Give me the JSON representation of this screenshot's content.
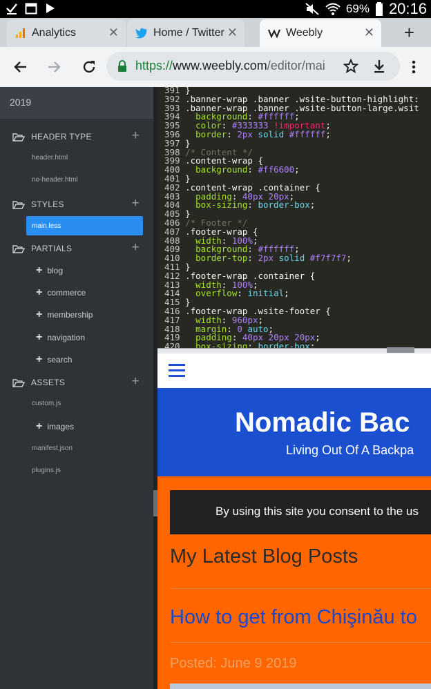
{
  "status_bar": {
    "battery": "69%",
    "time": "20:16"
  },
  "tabs": [
    {
      "title": "Analytics",
      "icon": "analytics-icon"
    },
    {
      "title": "Home / Twitter",
      "icon": "twitter-icon"
    },
    {
      "title": "Weebly",
      "icon": "weebly-icon",
      "active": true
    }
  ],
  "toolbar": {
    "url_scheme": "https://",
    "url_host": "www.weebly.com",
    "url_path": "/editor/mai"
  },
  "sidebar": {
    "year": "2019",
    "sections": {
      "header_type": {
        "label": "HEADER TYPE",
        "files": [
          "header.html",
          "no-header.html"
        ]
      },
      "styles": {
        "label": "STYLES",
        "active_file": "main.less"
      },
      "partials": {
        "label": "PARTIALS",
        "folders": [
          "blog",
          "commerce",
          "membership",
          "navigation",
          "search"
        ]
      },
      "assets": {
        "label": "ASSETS",
        "file_top": "custom.js",
        "folder": "images",
        "files_bottom": [
          "manifest.json",
          "plugins.js"
        ]
      }
    }
  },
  "editor": {
    "lines": [
      {
        "n": "391",
        "t": "}"
      },
      {
        "n": "392",
        "t": ".banner-wrap .banner .wsite-button-highlight:"
      },
      {
        "n": "393",
        "t": ".banner-wrap .banner .wsite-button-large.wsit"
      },
      {
        "n": "394",
        "t": "  background: #ffffff;"
      },
      {
        "n": "395",
        "t": "  color: #333333 !important;"
      },
      {
        "n": "396",
        "t": "  border: 2px solid #ffffff;"
      },
      {
        "n": "397",
        "t": "}"
      },
      {
        "n": "398",
        "t": "/* Content */"
      },
      {
        "n": "399",
        "t": ".content-wrap {"
      },
      {
        "n": "400",
        "t": "  background: #ff6600;"
      },
      {
        "n": "401",
        "t": "}"
      },
      {
        "n": "402",
        "t": ".content-wrap .container {"
      },
      {
        "n": "403",
        "t": "  padding: 40px 20px;"
      },
      {
        "n": "404",
        "t": "  box-sizing: border-box;"
      },
      {
        "n": "405",
        "t": "}"
      },
      {
        "n": "406",
        "t": "/* Footer */"
      },
      {
        "n": "407",
        "t": ".footer-wrap {"
      },
      {
        "n": "408",
        "t": "  width: 100%;"
      },
      {
        "n": "409",
        "t": "  background: #ffffff;"
      },
      {
        "n": "410",
        "t": "  border-top: 2px solid #f7f7f7;"
      },
      {
        "n": "411",
        "t": "}"
      },
      {
        "n": "412",
        "t": ".footer-wrap .container {"
      },
      {
        "n": "413",
        "t": "  width: 100%;"
      },
      {
        "n": "414",
        "t": "  overflow: initial;"
      },
      {
        "n": "415",
        "t": "}"
      },
      {
        "n": "416",
        "t": ".footer-wrap .wsite-footer {"
      },
      {
        "n": "417",
        "t": "  width: 960px;"
      },
      {
        "n": "418",
        "t": "  margin: 0 auto;"
      },
      {
        "n": "419",
        "t": "  padding: 40px 20px 20px;"
      },
      {
        "n": "420",
        "t": "  box-sizing: border-box;"
      }
    ]
  },
  "preview": {
    "site_title": "Nomadic Bac",
    "tagline": "Living Out Of A Backpa",
    "cookie_text": "By using this site you consent to the us",
    "blog_heading": "My Latest Blog Posts",
    "post_title": "How to get from Chişinău to",
    "posted": "Posted: June 9 2019"
  },
  "colors": {
    "accent": "#2a8ef0",
    "banner": "#1a4fcf",
    "content": "#ff6600"
  }
}
